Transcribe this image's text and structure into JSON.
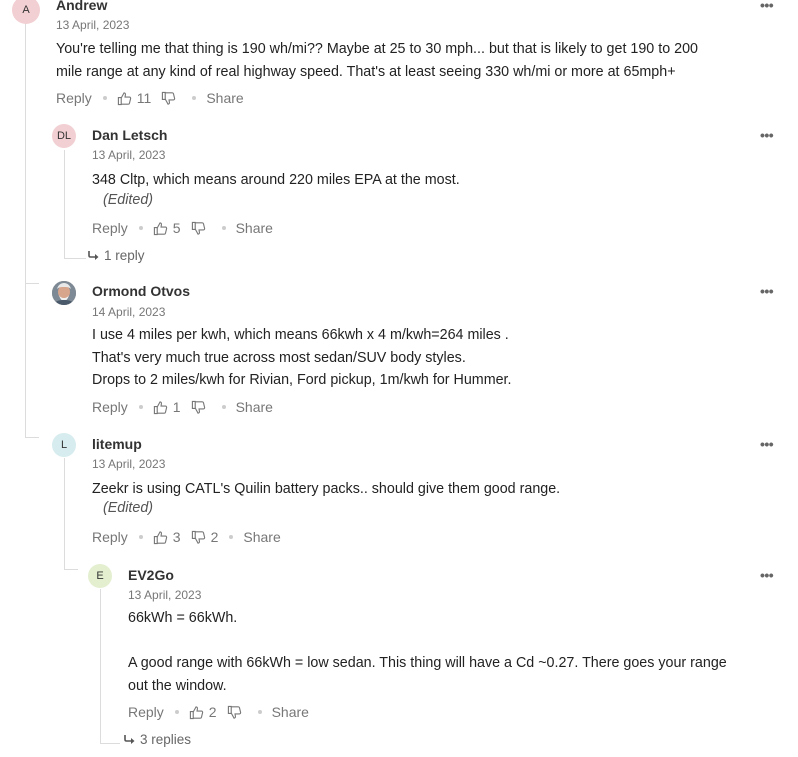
{
  "labels": {
    "reply": "Reply",
    "share": "Share",
    "more": "•••"
  },
  "comments": [
    {
      "avatar": "A",
      "name": "Andrew",
      "date": "13 April, 2023",
      "lines": [
        "You're telling me that thing is 190 wh/mi?? Maybe at 25 to 30 mph... but that is likely to get 190 to 200",
        "mile range at any kind of real highway speed. That's at least seeing 330 wh/mi or more at 65mph+"
      ],
      "likes": "11",
      "dislikes": ""
    },
    {
      "avatar": "DL",
      "name": "Dan Letsch",
      "date": "13 April, 2023",
      "lines": [
        "348 Cltp, which means around 220 miles EPA at the most."
      ],
      "edited": "(Edited)",
      "likes": "5",
      "dislikes": "",
      "replies": "1 reply"
    },
    {
      "avatar": "",
      "name": "Ormond Otvos",
      "date": "14 April, 2023",
      "lines": [
        "I use 4 miles per kwh, which means 66kwh x 4 m/kwh=264 miles .",
        "That's very much true across most sedan/SUV body styles.",
        "Drops to 2 miles/kwh for Rivian, Ford pickup, 1m/kwh for Hummer."
      ],
      "likes": "1",
      "dislikes": ""
    },
    {
      "avatar": "L",
      "name": "litemup",
      "date": "13 April, 2023",
      "lines": [
        "Zeekr is using CATL's Quilin battery packs.. should give them good range."
      ],
      "edited": "(Edited)",
      "likes": "3",
      "dislikes": "2"
    },
    {
      "avatar": "E",
      "name": "EV2Go",
      "date": "13 April, 2023",
      "lines": [
        "66kWh = 66kWh.",
        "",
        "A good range with 66kWh = low sedan. This thing will have a Cd ~0.27. There goes your range",
        "out the window."
      ],
      "likes": "2",
      "dislikes": "",
      "replies": "3 replies"
    }
  ],
  "colors": {
    "avatar_A": "#f2cfd2",
    "avatar_DL": "#f2cfd2",
    "avatar_L": "#d6ecee",
    "avatar_E": "#e3efcf"
  }
}
